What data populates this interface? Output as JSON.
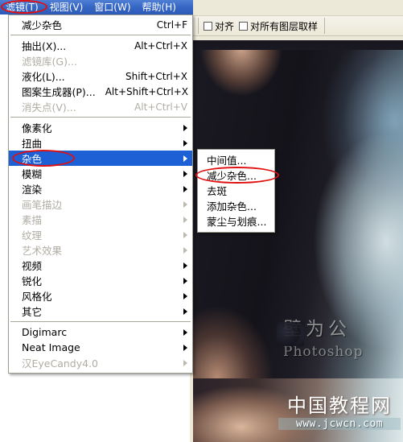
{
  "menubar": {
    "items": [
      {
        "label": "滤镜(T)",
        "name": "menubar-filter",
        "active": true
      },
      {
        "label": "视图(V)",
        "name": "menubar-view",
        "active": false
      },
      {
        "label": "窗口(W)",
        "name": "menubar-window",
        "active": false
      },
      {
        "label": "帮助(H)",
        "name": "menubar-help",
        "active": false
      }
    ]
  },
  "toolbar": {
    "align_label": "对齐",
    "sample_all_layers_label": "对所有图层取样"
  },
  "menu": {
    "items": [
      {
        "label": "减少杂色",
        "accel": "Ctrl+F",
        "disabled": false,
        "submenu": false,
        "selected": false
      },
      {
        "separator": true
      },
      {
        "label": "抽出(X)...",
        "accel": "Alt+Ctrl+X",
        "disabled": false,
        "submenu": false,
        "selected": false
      },
      {
        "label": "滤镜库(G)...",
        "accel": "",
        "disabled": true,
        "submenu": false,
        "selected": false
      },
      {
        "label": "液化(L)...",
        "accel": "Shift+Ctrl+X",
        "disabled": false,
        "submenu": false,
        "selected": false
      },
      {
        "label": "图案生成器(P)...",
        "accel": "Alt+Shift+Ctrl+X",
        "disabled": false,
        "submenu": false,
        "selected": false
      },
      {
        "label": "消失点(V)...",
        "accel": "Alt+Ctrl+V",
        "disabled": true,
        "submenu": false,
        "selected": false
      },
      {
        "separator": true
      },
      {
        "label": "像素化",
        "accel": "",
        "disabled": false,
        "submenu": true,
        "selected": false
      },
      {
        "label": "扭曲",
        "accel": "",
        "disabled": false,
        "submenu": true,
        "selected": false
      },
      {
        "label": "杂色",
        "accel": "",
        "disabled": false,
        "submenu": true,
        "selected": true
      },
      {
        "label": "模糊",
        "accel": "",
        "disabled": false,
        "submenu": true,
        "selected": false
      },
      {
        "label": "渲染",
        "accel": "",
        "disabled": false,
        "submenu": true,
        "selected": false
      },
      {
        "label": "画笔描边",
        "accel": "",
        "disabled": true,
        "submenu": true,
        "selected": false
      },
      {
        "label": "素描",
        "accel": "",
        "disabled": true,
        "submenu": true,
        "selected": false
      },
      {
        "label": "纹理",
        "accel": "",
        "disabled": true,
        "submenu": true,
        "selected": false
      },
      {
        "label": "艺术效果",
        "accel": "",
        "disabled": true,
        "submenu": true,
        "selected": false
      },
      {
        "label": "视频",
        "accel": "",
        "disabled": false,
        "submenu": true,
        "selected": false
      },
      {
        "label": "锐化",
        "accel": "",
        "disabled": false,
        "submenu": true,
        "selected": false
      },
      {
        "label": "风格化",
        "accel": "",
        "disabled": false,
        "submenu": true,
        "selected": false
      },
      {
        "label": "其它",
        "accel": "",
        "disabled": false,
        "submenu": true,
        "selected": false
      },
      {
        "separator": true
      },
      {
        "label": "Digimarc",
        "accel": "",
        "disabled": false,
        "submenu": true,
        "selected": false
      },
      {
        "label": "Neat Image",
        "accel": "",
        "disabled": false,
        "submenu": true,
        "selected": false
      },
      {
        "label": "汉EyeCandy4.0",
        "accel": "",
        "disabled": true,
        "submenu": true,
        "selected": false
      }
    ]
  },
  "submenu": {
    "items": [
      {
        "label": "中间值..."
      },
      {
        "label": "减少杂色..."
      },
      {
        "label": "去斑"
      },
      {
        "label": "添加杂色..."
      },
      {
        "label": "蒙尘与划痕..."
      }
    ]
  },
  "annotations": {
    "highlight_color": "#e01010",
    "circled": [
      "滤镜(T)",
      "杂色",
      "减少杂色..."
    ]
  },
  "watermark": {
    "chinese_text": "壁为公",
    "brand_text": "Photoshop"
  },
  "banner": {
    "site_name": "中国教程网",
    "url": "www.jcwcn.com"
  }
}
